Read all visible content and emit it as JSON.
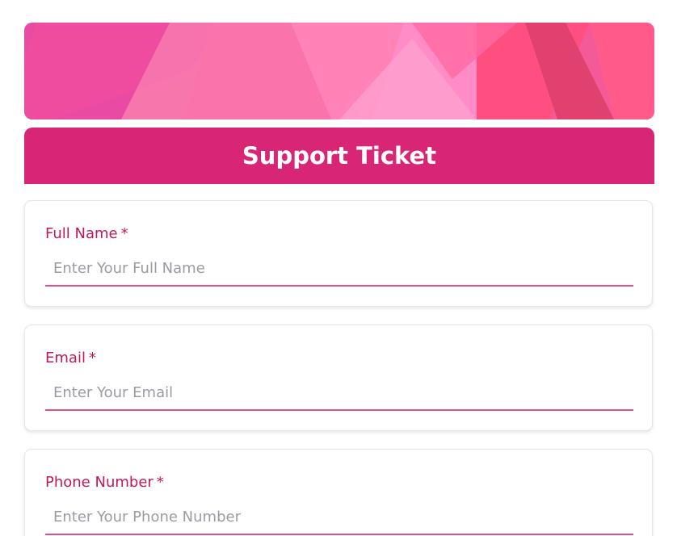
{
  "form": {
    "title": "Support Ticket",
    "fields": [
      {
        "label": "Full Name",
        "required_mark": "*",
        "placeholder": "Enter Your Full Name",
        "value": ""
      },
      {
        "label": "Email",
        "required_mark": "*",
        "placeholder": "Enter Your Email",
        "value": ""
      },
      {
        "label": "Phone Number",
        "required_mark": "*",
        "placeholder": "Enter Your Phone Number",
        "value": ""
      }
    ]
  },
  "colors": {
    "accent": "#d92575",
    "label": "#c2185b",
    "underline": "#e0517f",
    "banner_base": "#f24d8c"
  }
}
